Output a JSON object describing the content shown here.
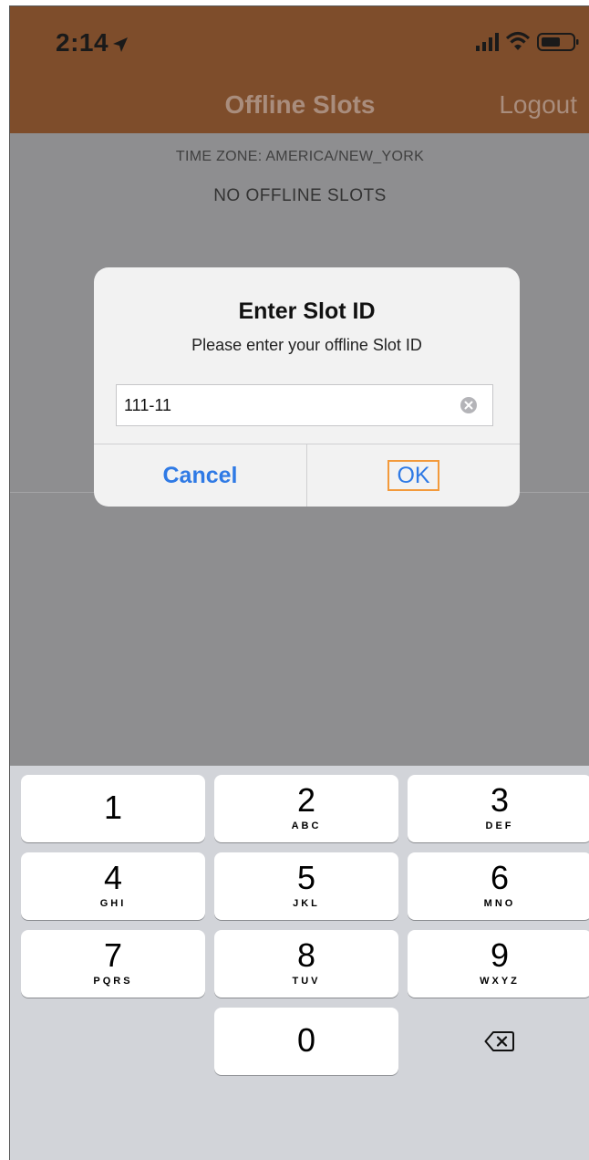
{
  "status_bar": {
    "time": "2:14",
    "icons": [
      "location-arrow-icon",
      "signal-icon",
      "wifi-icon",
      "battery-icon"
    ]
  },
  "nav": {
    "title": "Offline Slots",
    "logout_label": "Logout"
  },
  "content": {
    "timezone_label": "TIME ZONE: AMERICA/NEW_YORK",
    "empty_label": "NO OFFLINE SLOTS"
  },
  "dialog": {
    "title": "Enter Slot ID",
    "message": "Please enter your offline Slot ID",
    "input_value": "111-11",
    "cancel_label": "Cancel",
    "ok_label": "OK"
  },
  "keyboard": {
    "keys": [
      {
        "digit": "1",
        "letters": ""
      },
      {
        "digit": "2",
        "letters": "ABC"
      },
      {
        "digit": "3",
        "letters": "DEF"
      },
      {
        "digit": "4",
        "letters": "GHI"
      },
      {
        "digit": "5",
        "letters": "JKL"
      },
      {
        "digit": "6",
        "letters": "MNO"
      },
      {
        "digit": "7",
        "letters": "PQRS"
      },
      {
        "digit": "8",
        "letters": "TUV"
      },
      {
        "digit": "9",
        "letters": "WXYZ"
      },
      {
        "digit": "0",
        "letters": ""
      }
    ],
    "delete_icon": "backspace-icon"
  },
  "colors": {
    "header": "#7e4d2b",
    "overlay": "#8e8e90",
    "accent": "#2f7ae5",
    "highlight": "#f39a3b",
    "keyboard_bg": "#d2d4d9"
  }
}
